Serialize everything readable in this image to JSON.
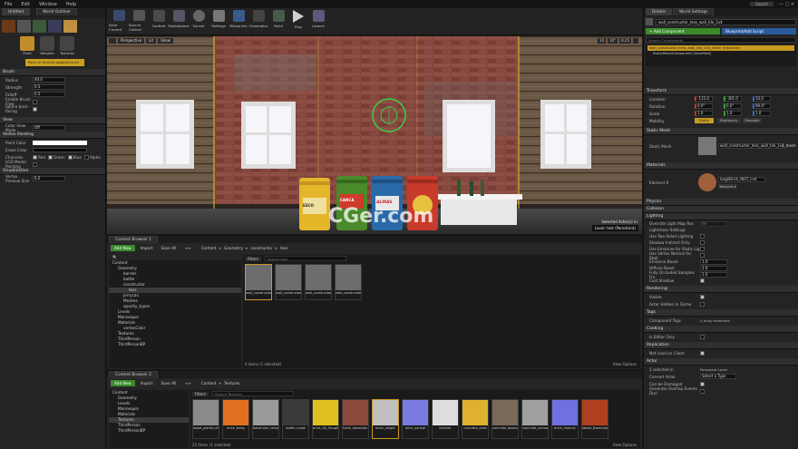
{
  "menu": [
    "File",
    "Edit",
    "Window",
    "Help"
  ],
  "editor_tabs": {
    "tab1": "Untitled",
    "tab2": "World Outliner",
    "tab3": "LuaIII",
    "tab4": "World Settings"
  },
  "search_placeholder": "Search",
  "window_ctrl": "— ▢ ✕",
  "modes": {
    "tools": [
      "Paint",
      "Weights",
      "Textures"
    ],
    "paint_tab": "Paint",
    "paint_notice": "Paint or directly applied to all LODs",
    "brush": {
      "header": "Brush",
      "radius_label": "Radius",
      "radius": "40.0",
      "strength_label": "Strength",
      "strength": "0.5",
      "falloff_label": "Falloff",
      "falloff": "0.5",
      "flow_label": "Enable Brush Flow",
      "backface_label": "Ignore back-facing"
    },
    "view": {
      "header": "View",
      "color_view_label": "Color View Mode",
      "color_view": "Off"
    },
    "vertex_painting": {
      "header": "Vertex Painting",
      "paint_color_label": "Paint Color",
      "erase_color_label": "Erase Color",
      "channels_label": "Channels",
      "channels": [
        "Red",
        "Green",
        "Blue",
        "Alpha"
      ],
      "lod_label": "LOD Model Painting"
    },
    "visualization": {
      "header": "Visualization",
      "preview_size_label": "Vertex Preview Size",
      "preview_size": "6.0"
    }
  },
  "toolbar": [
    "Save Current",
    "Source Control",
    "Content",
    "Marketplace",
    "Source",
    "Settings",
    "Blueprints",
    "Cinematics",
    "Build",
    "Play",
    "Launch"
  ],
  "viewport": {
    "perspective": "Perspective",
    "lit": "Lit",
    "show": "Show",
    "grid": "10",
    "rot": "10°",
    "scale": "0.25",
    "actors": "Selected Actor(s) in:",
    "level_label": "Level:",
    "level_name": "test (Persistent)",
    "cans": [
      "ESCO",
      "CANCA",
      "ALMAS",
      ""
    ]
  },
  "content_browser": {
    "tab": "Content Browser 1",
    "add_new": "Add New",
    "import": "Import",
    "save_all": "Save All",
    "breadcrumb": [
      "Content",
      "Geometry",
      "constructor",
      "tess"
    ],
    "filters": "Filters",
    "search_placeholder": "Search tess",
    "tree": [
      "Content",
      "Geometry",
      "barrels",
      "bottle",
      "constructor",
      "tess",
      "jerrycan",
      "Meshes",
      "opacity_types",
      "Levels",
      "Mannequin",
      "Materials",
      "vertexColor",
      "Textures",
      "ThirdPerson",
      "ThirdPersonBP"
    ],
    "assets": [
      "wall_constructor_tess_door_6fx",
      "wall_constructor_tess_wall_6fx",
      "wall_constructor_tess_window_6fx",
      "wall_constructor_tess_window_6fx"
    ],
    "status": "4 items (1 selected)",
    "view_options": "View Options"
  },
  "content_browser2": {
    "tab": "Content Browser 2",
    "add_new": "Add New",
    "import": "Import",
    "save_all": "Save All",
    "breadcrumb": [
      "Content",
      "Textures"
    ],
    "filters": "Filters",
    "search_placeholder": "Search Textures",
    "tree": [
      "Content",
      "Geometry",
      "Levels",
      "Mannequin",
      "Materials",
      "Textures",
      "ThirdPerson",
      "ThirdPersonBP"
    ],
    "assets": [
      "wood_planks_diff",
      "brick_temp",
      "baseColor_temp",
      "bottle_mask",
      "brick_AO_Roughness",
      "brick_basecolor",
      "brick_height",
      "brick_normal",
      "checker",
      "concrete_brkd",
      "concrete_basecolor",
      "concrete_normal",
      "brick_dummy",
      "labels_BaseColor"
    ],
    "status": "25 items (1 selected)",
    "view_options": "View Options"
  },
  "details": {
    "tab": "Details",
    "tab2": "World Settings",
    "actor_name": "wall_constructor_tess_wall_tile_1x4",
    "add_component": "+ Add Component",
    "blueprint_script": "Blueprint/Add Script",
    "search_placeholder": "Search Components",
    "component_root": "wall_constructor_tess_wall_tile_1x4_mesh (Instance)",
    "component_child": "StaticMeshComponent (Inherited)",
    "transform": {
      "header": "Transform",
      "location_label": "Location",
      "location": [
        "-115.0",
        "-301.0",
        "10.0"
      ],
      "rotation_label": "Rotation",
      "rotation": [
        "0.0°",
        "0.0°",
        "90.0°"
      ],
      "scale_label": "Scale",
      "scale": [
        "1.0",
        "1.0",
        "1.0"
      ],
      "mobility_label": "Mobility",
      "mobility": [
        "Static",
        "Stationary",
        "Movable"
      ]
    },
    "static_mesh": {
      "header": "Static Mesh",
      "label": "Static Mesh",
      "value": "wall_constructor_tess_wall_tile_1x4_mesh"
    },
    "materials": {
      "header": "Materials",
      "label": "Element 0",
      "value": "largeBrick_INST_inst",
      "textures": "Textures ▾"
    },
    "sections": [
      "Physics",
      "Collision",
      "Lighting"
    ],
    "lighting_rows": [
      "Override Light Map Res",
      "Lightmass Settings",
      "Use Two Sided Lighting",
      "Shadow Indirect Only",
      "Use Emissive for Static Lig",
      "Use Vertex Normal for Stati",
      "Emissive Boost",
      "Diffuse Boost",
      "Fully Occluded Samples Fra",
      "Cast Shadow"
    ],
    "lighting_values": [
      "64",
      "1.0",
      "1.0",
      "1.0"
    ],
    "rendering": {
      "header": "Rendering",
      "rows": [
        "Visible",
        "Actor Hidden In Game"
      ]
    },
    "tags": {
      "header": "Tags",
      "label": "Component Tags",
      "value": "0 Array elements"
    },
    "cooking": {
      "header": "Cooking",
      "label": "Is Editor Only"
    },
    "replication": {
      "header": "Replication",
      "label": "Net Load on Client"
    },
    "actor": {
      "header": "Actor",
      "rows": [
        "1 selected in",
        "Convert Actor",
        "Can be Damaged",
        "Generate Overlap Events Duri"
      ],
      "level_label": "Persistent Level",
      "convert_value": "Select a Type"
    }
  },
  "watermark": "CGer.com"
}
